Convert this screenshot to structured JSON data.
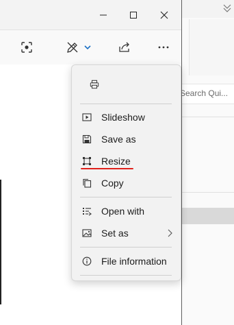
{
  "window": {
    "controls": {
      "minimize": "minimize-icon",
      "maximize": "maximize-icon",
      "close": "close-icon"
    }
  },
  "toolbar": {
    "icons": [
      "crop-icon",
      "edit-draw-icon",
      "chevron-down-icon",
      "share-icon",
      "more-icon"
    ]
  },
  "background_window": {
    "search_placeholder": "Search Qui..."
  },
  "context_menu": {
    "items": [
      {
        "label": "Slideshow",
        "icon": "slideshow-icon"
      },
      {
        "label": "Save as",
        "icon": "save-icon"
      },
      {
        "label": "Resize",
        "icon": "resize-icon"
      },
      {
        "label": "Copy",
        "icon": "copy-icon"
      },
      {
        "label": "Open with",
        "icon": "open-with-icon"
      },
      {
        "label": "Set as",
        "icon": "set-as-icon"
      },
      {
        "label": "File information",
        "icon": "info-icon"
      }
    ],
    "print_icon": "printer-icon",
    "highlight_color": "#e0211b"
  }
}
